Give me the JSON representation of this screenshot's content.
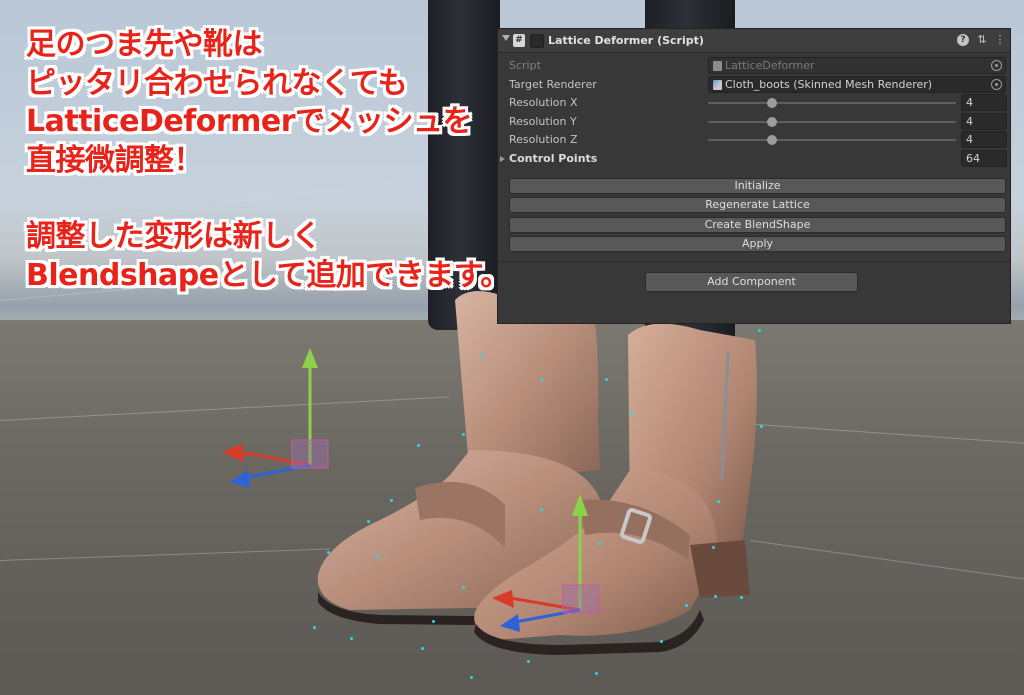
{
  "caption": {
    "line1": "足のつま先や靴は",
    "line2": "ピッタリ合わせられなくても",
    "line3": "LatticeDeformerでメッシュを",
    "line4": "直接微調整！",
    "line5": "調整した変形は新しく",
    "line6": "Blendshapeとして追加できます。",
    "color": "#e8231a"
  },
  "inspector": {
    "title": "Lattice Deformer (Script)",
    "script_icon": "#",
    "icons": [
      "help-icon",
      "preset-icon",
      "menu-icon"
    ],
    "script": {
      "label": "Script",
      "value": "LatticeDeformer"
    },
    "target_renderer": {
      "label": "Target Renderer",
      "value": "Cloth_boots (Skinned Mesh Renderer)"
    },
    "resolution_x": {
      "label": "Resolution X",
      "value": "4"
    },
    "resolution_y": {
      "label": "Resolution Y",
      "value": "4"
    },
    "resolution_z": {
      "label": "Resolution Z",
      "value": "4"
    },
    "control_points": {
      "label": "Control Points",
      "value": "64"
    },
    "buttons": {
      "initialize": "Initialize",
      "regenerate": "Regenerate Lattice",
      "create_blendshape": "Create BlendShape",
      "apply": "Apply"
    },
    "add_component": "Add Component"
  }
}
